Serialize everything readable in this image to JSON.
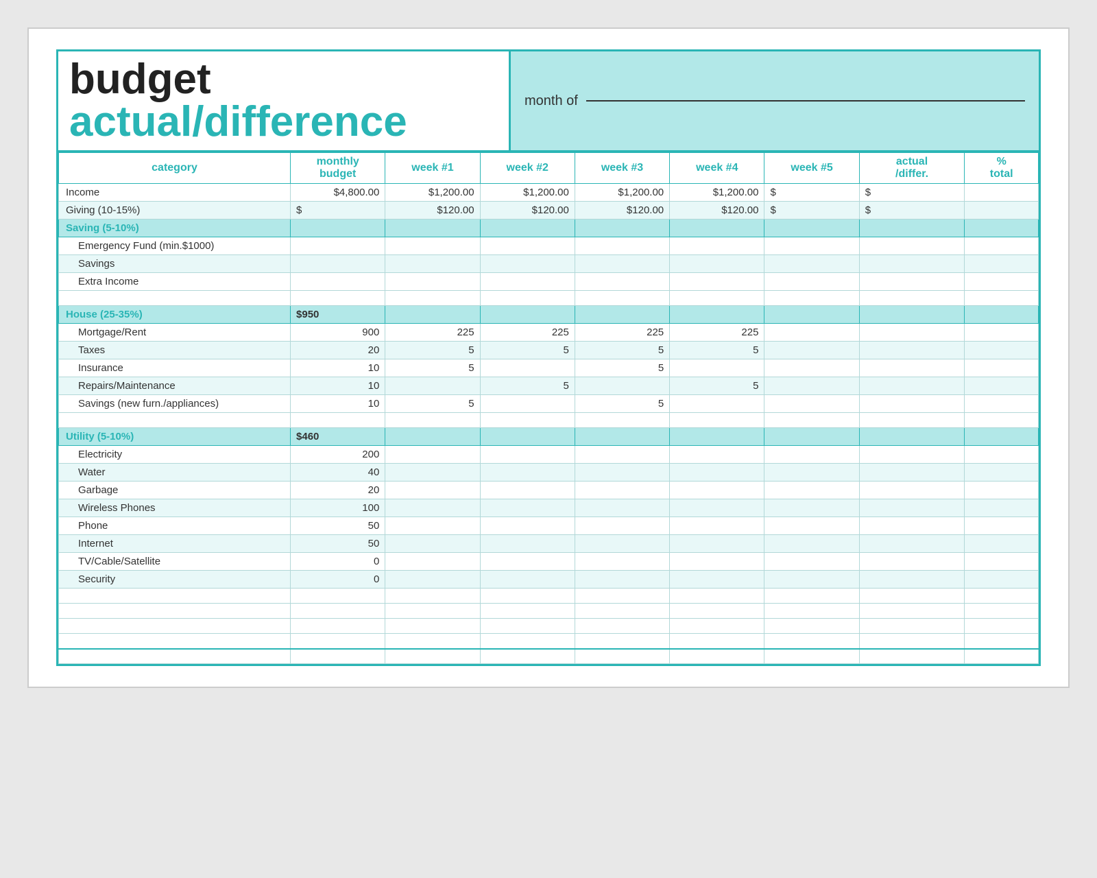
{
  "header": {
    "title_budget": "budget",
    "title_actual": "actual/difference",
    "month_label": "month of"
  },
  "columns": {
    "category": "category",
    "monthly_budget": [
      "monthly",
      "budget"
    ],
    "week1": "week #1",
    "week2": "week #2",
    "week3": "week #3",
    "week4": "week #4",
    "week5": "week #5",
    "actual_differ": [
      "actual",
      "/differ."
    ],
    "pct_total": [
      "%",
      "total"
    ]
  },
  "sections": [
    {
      "id": "income",
      "rows": [
        {
          "category": "Income",
          "monthly": "$4,800.00",
          "w1": "$1,200.00",
          "w2": "$1,200.00",
          "w3": "$1,200.00",
          "w4": "$1,200.00",
          "w5": "$",
          "actual": "$",
          "pct": "",
          "is_bold": false
        }
      ]
    },
    {
      "id": "giving",
      "rows": [
        {
          "category": "Giving (10-15%)",
          "monthly": "$",
          "w1": "$120.00",
          "w2": "$120.00",
          "w3": "$120.00",
          "w4": "$120.00",
          "w5": "$",
          "actual": "$",
          "pct": "",
          "is_bold": false
        }
      ]
    },
    {
      "id": "saving",
      "label": "Saving (5-10%)",
      "monthly": "",
      "rows": [
        {
          "category": "Emergency Fund (min.$1000)",
          "monthly": "",
          "w1": "",
          "w2": "",
          "w3": "",
          "w4": "",
          "w5": "",
          "actual": "",
          "pct": ""
        },
        {
          "category": "Savings",
          "monthly": "",
          "w1": "",
          "w2": "",
          "w3": "",
          "w4": "",
          "w5": "",
          "actual": "",
          "pct": ""
        },
        {
          "category": "Extra Income",
          "monthly": "",
          "w1": "",
          "w2": "",
          "w3": "",
          "w4": "",
          "w5": "",
          "actual": "",
          "pct": ""
        }
      ]
    },
    {
      "id": "house",
      "label": "House (25-35%)",
      "monthly": "$950",
      "rows": [
        {
          "category": "Mortgage/Rent",
          "monthly": "900",
          "w1": "225",
          "w2": "225",
          "w3": "225",
          "w4": "225",
          "w5": "",
          "actual": "",
          "pct": ""
        },
        {
          "category": "Taxes",
          "monthly": "20",
          "w1": "5",
          "w2": "5",
          "w3": "5",
          "w4": "5",
          "w5": "",
          "actual": "",
          "pct": ""
        },
        {
          "category": "Insurance",
          "monthly": "10",
          "w1": "5",
          "w2": "",
          "w3": "5",
          "w4": "",
          "w5": "",
          "actual": "",
          "pct": ""
        },
        {
          "category": "Repairs/Maintenance",
          "monthly": "10",
          "w1": "",
          "w2": "5",
          "w3": "",
          "w4": "5",
          "w5": "",
          "actual": "",
          "pct": ""
        },
        {
          "category": "Savings (new furn./appliances)",
          "monthly": "10",
          "w1": "5",
          "w2": "",
          "w3": "5",
          "w4": "",
          "w5": "",
          "actual": "",
          "pct": ""
        }
      ]
    },
    {
      "id": "utility",
      "label": "Utility (5-10%)",
      "monthly": "$460",
      "rows": [
        {
          "category": "Electricity",
          "monthly": "200",
          "w1": "",
          "w2": "",
          "w3": "",
          "w4": "",
          "w5": "",
          "actual": "",
          "pct": ""
        },
        {
          "category": "Water",
          "monthly": "40",
          "w1": "",
          "w2": "",
          "w3": "",
          "w4": "",
          "w5": "",
          "actual": "",
          "pct": ""
        },
        {
          "category": "Garbage",
          "monthly": "20",
          "w1": "",
          "w2": "",
          "w3": "",
          "w4": "",
          "w5": "",
          "actual": "",
          "pct": ""
        },
        {
          "category": "Wireless Phones",
          "monthly": "100",
          "w1": "",
          "w2": "",
          "w3": "",
          "w4": "",
          "w5": "",
          "actual": "",
          "pct": ""
        },
        {
          "category": "Phone",
          "monthly": "50",
          "w1": "",
          "w2": "",
          "w3": "",
          "w4": "",
          "w5": "",
          "actual": "",
          "pct": ""
        },
        {
          "category": "Internet",
          "monthly": "50",
          "w1": "",
          "w2": "",
          "w3": "",
          "w4": "",
          "w5": "",
          "actual": "",
          "pct": ""
        },
        {
          "category": "TV/Cable/Satellite",
          "monthly": "0",
          "w1": "",
          "w2": "",
          "w3": "",
          "w4": "",
          "w5": "",
          "actual": "",
          "pct": ""
        },
        {
          "category": "Security",
          "monthly": "0",
          "w1": "",
          "w2": "",
          "w3": "",
          "w4": "",
          "w5": "",
          "actual": "",
          "pct": ""
        }
      ]
    }
  ],
  "extra_blank_rows": 4
}
